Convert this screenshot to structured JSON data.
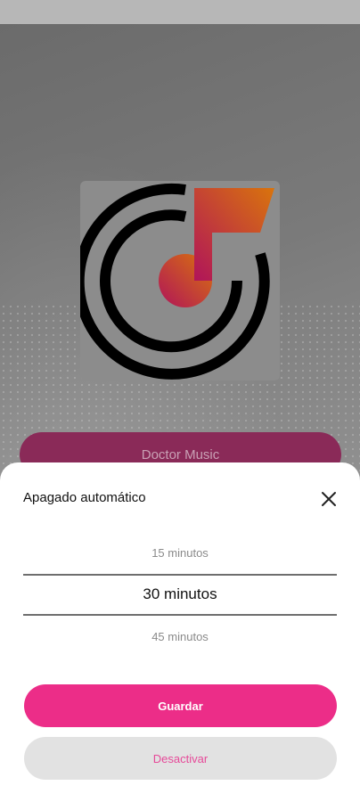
{
  "background": {
    "artist_button_label": "Doctor Music",
    "logo_icon": "doctor-music-logo"
  },
  "sheet": {
    "title": "Apagado automático",
    "close_icon": "close-icon",
    "options": [
      "15 minutos",
      "30 minutos",
      "45 minutos"
    ],
    "selected": "30 minutos",
    "save_label": "Guardar",
    "deactivate_label": "Desactivar"
  },
  "colors": {
    "accent": "#ec2d88",
    "secondary_button_bg": "#e2e2e2",
    "secondary_button_text": "#e64a99",
    "sheet_bg": "#ffffff"
  }
}
